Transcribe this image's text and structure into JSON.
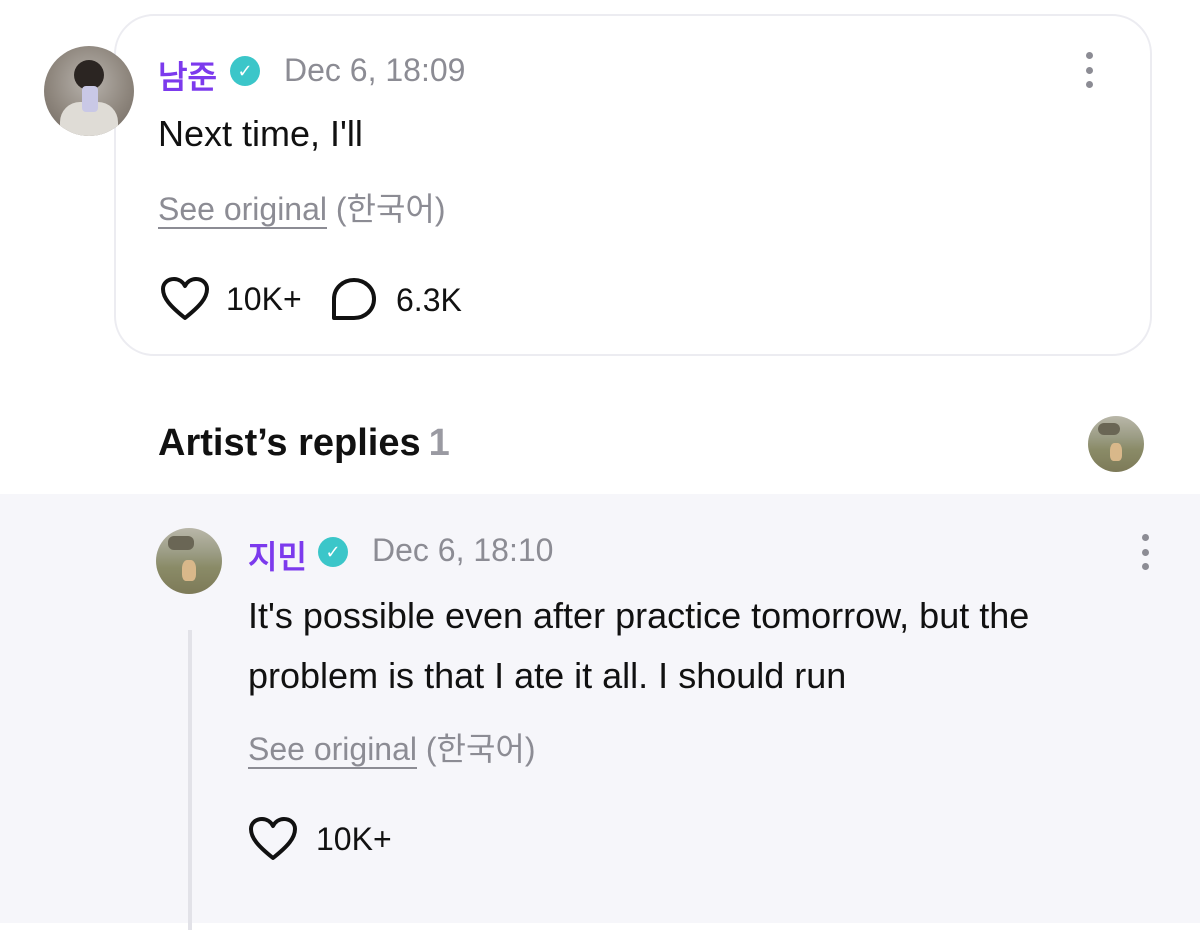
{
  "comment": {
    "author": "남준",
    "timestamp": "Dec 6, 18:09",
    "text": "Next time, I'll",
    "see_original": "See original",
    "language": "(한국어)",
    "likes": "10K+",
    "replies_count": "6.3K",
    "verified_glyph": "✓"
  },
  "artist_replies": {
    "title": "Artist’s replies",
    "count": "1"
  },
  "reply": {
    "author": "지민",
    "timestamp": "Dec 6, 18:10",
    "text": "It's possible even after practice tomorrow, but the problem is that I ate it all. I should run",
    "see_original": "See original",
    "language": "(한국어)",
    "likes": "10K+",
    "verified_glyph": "✓"
  },
  "colors": {
    "name_accent": "#7c3aed",
    "verified_badge": "#3bc6c9",
    "muted_text": "#8c8c94",
    "reply_background": "#f6f6fa"
  },
  "icons": [
    "verified-badge-icon",
    "kebab-menu-icon",
    "heart-icon",
    "comment-bubble-icon"
  ]
}
